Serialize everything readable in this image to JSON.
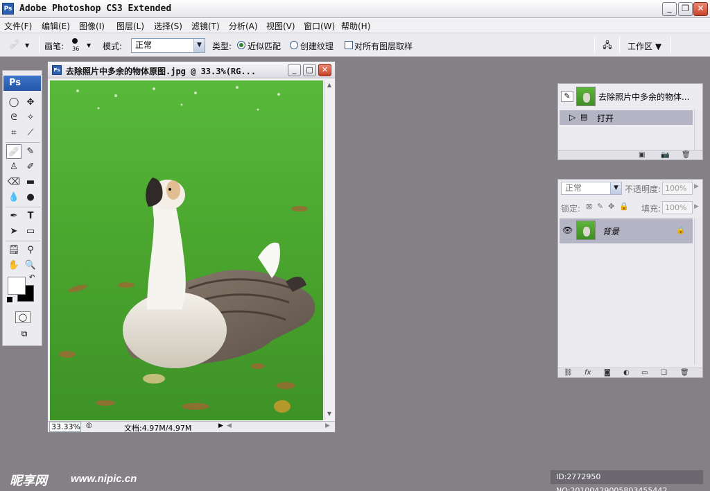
{
  "window": {
    "app_icon": "Ps",
    "title": "Adobe Photoshop CS3 Extended",
    "minimize": "_",
    "restore": "❐",
    "close": "✕"
  },
  "menu": [
    "文件(F)",
    "编辑(E)",
    "图像(I)",
    "图层(L)",
    "选择(S)",
    "滤镜(T)",
    "分析(A)",
    "视图(V)",
    "窗口(W)",
    "帮助(H)"
  ],
  "options": {
    "brush_label": "画笔:",
    "brush_size": "36",
    "mode_label": "模式:",
    "mode_value": "正常",
    "type_label": "类型:",
    "radio_proximity": "近似匹配",
    "radio_texture": "创建纹理",
    "sample_all_layers": "对所有图层取样",
    "workspace": "工作区 ▼"
  },
  "toolbox": {
    "header": "Ps"
  },
  "document": {
    "icon": "Ps",
    "title": "去除照片中多余的物体原图.jpg @ 33.3%(RG...",
    "zoom": "33.33%",
    "doc_info": "文档:4.97M/4.97M"
  },
  "history_panel": {
    "snapshot_name": "去除照片中多余的物体...",
    "step": "打开"
  },
  "layers_panel": {
    "blend_mode": "正常",
    "opacity_label": "不透明度:",
    "opacity_value": "100%",
    "lock_label": "锁定:",
    "fill_label": "填充:",
    "fill_value": "100%",
    "layer_name": "背景"
  },
  "watermark": {
    "logo": "昵享网",
    "url": "www.nipic.cn",
    "id": "ID:2772950 NO:20100429005803455442"
  }
}
